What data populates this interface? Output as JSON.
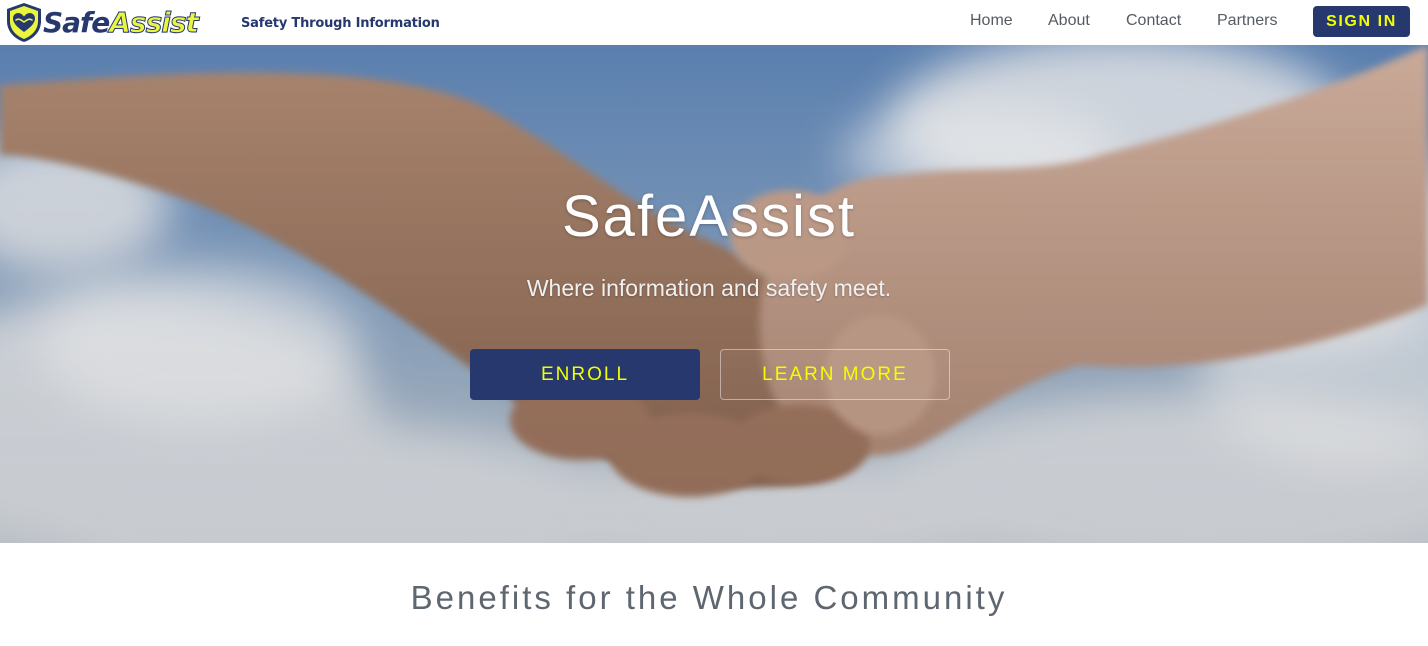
{
  "brand": {
    "name_part1": "Safe",
    "name_part2": "Assist",
    "tagline": "Safety Through Information",
    "primary_color": "#26386e",
    "accent_color": "#f2ff00"
  },
  "nav": {
    "items": [
      {
        "label": "Home"
      },
      {
        "label": "About"
      },
      {
        "label": "Contact"
      },
      {
        "label": "Partners"
      }
    ],
    "signin_label": "SIGN IN"
  },
  "hero": {
    "title": "SafeAssist",
    "subtitle": "Where information and safety meet.",
    "enroll_label": "ENROLL",
    "learn_more_label": "LEARN MORE",
    "background_image": "handshake-over-sky-photo"
  },
  "benefits": {
    "title": "Benefits for the Whole Community"
  }
}
